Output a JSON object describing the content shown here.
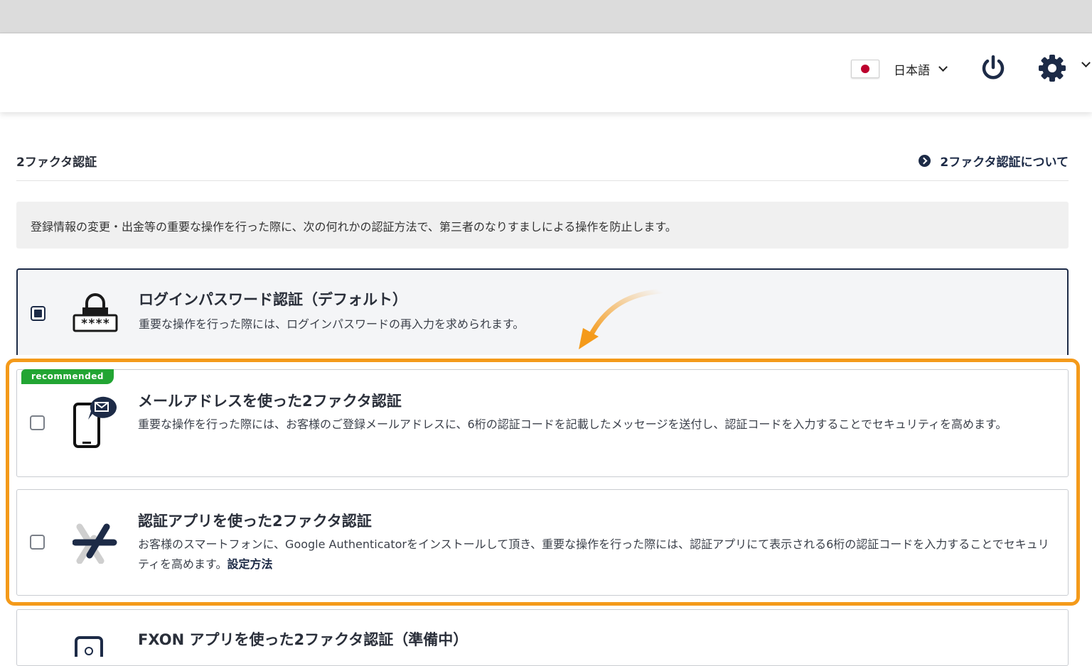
{
  "header": {
    "language_label": "日本語"
  },
  "page": {
    "title": "2ファクタ認証",
    "about_link": "2ファクタ認証について",
    "info_text": "登録情報の変更・出金等の重要な操作を行った際に、次の何れかの認証方法で、第三者のなりすましによる操作を防止します。"
  },
  "options": [
    {
      "title": "ログインパスワード認証（デフォルト）",
      "description": "重要な操作を行った際には、ログインパスワードの再入力を求められます。",
      "selected": true,
      "icon": "lock-password-icon"
    },
    {
      "badge": "recommended",
      "title": "メールアドレスを使った2ファクタ認証",
      "description": "重要な操作を行った際には、お客様のご登録メールアドレスに、6桁の認証コードを記載したメッセージを送付し、認証コードを入力することでセキュリティを高めます。",
      "selected": false,
      "icon": "phone-mail-icon"
    },
    {
      "title": "認証アプリを使った2ファクタ認証",
      "description": "お客様のスマートフォンに、Google Authenticatorをインストールして頂き、重要な操作を行った際には、認証アプリにて表示される6桁の認証コードを入力することでセキュリティを高めます。",
      "setup_link": "設定方法",
      "selected": false,
      "icon": "authenticator-icon"
    },
    {
      "title": "FXON アプリを使った2ファクタ認証（準備中）",
      "icon": "fxon-app-icon"
    }
  ],
  "colors": {
    "navy": "#1d2b47",
    "highlight_orange": "#f49a1a",
    "badge_green": "#22a533",
    "flag_red": "#bc002d"
  }
}
